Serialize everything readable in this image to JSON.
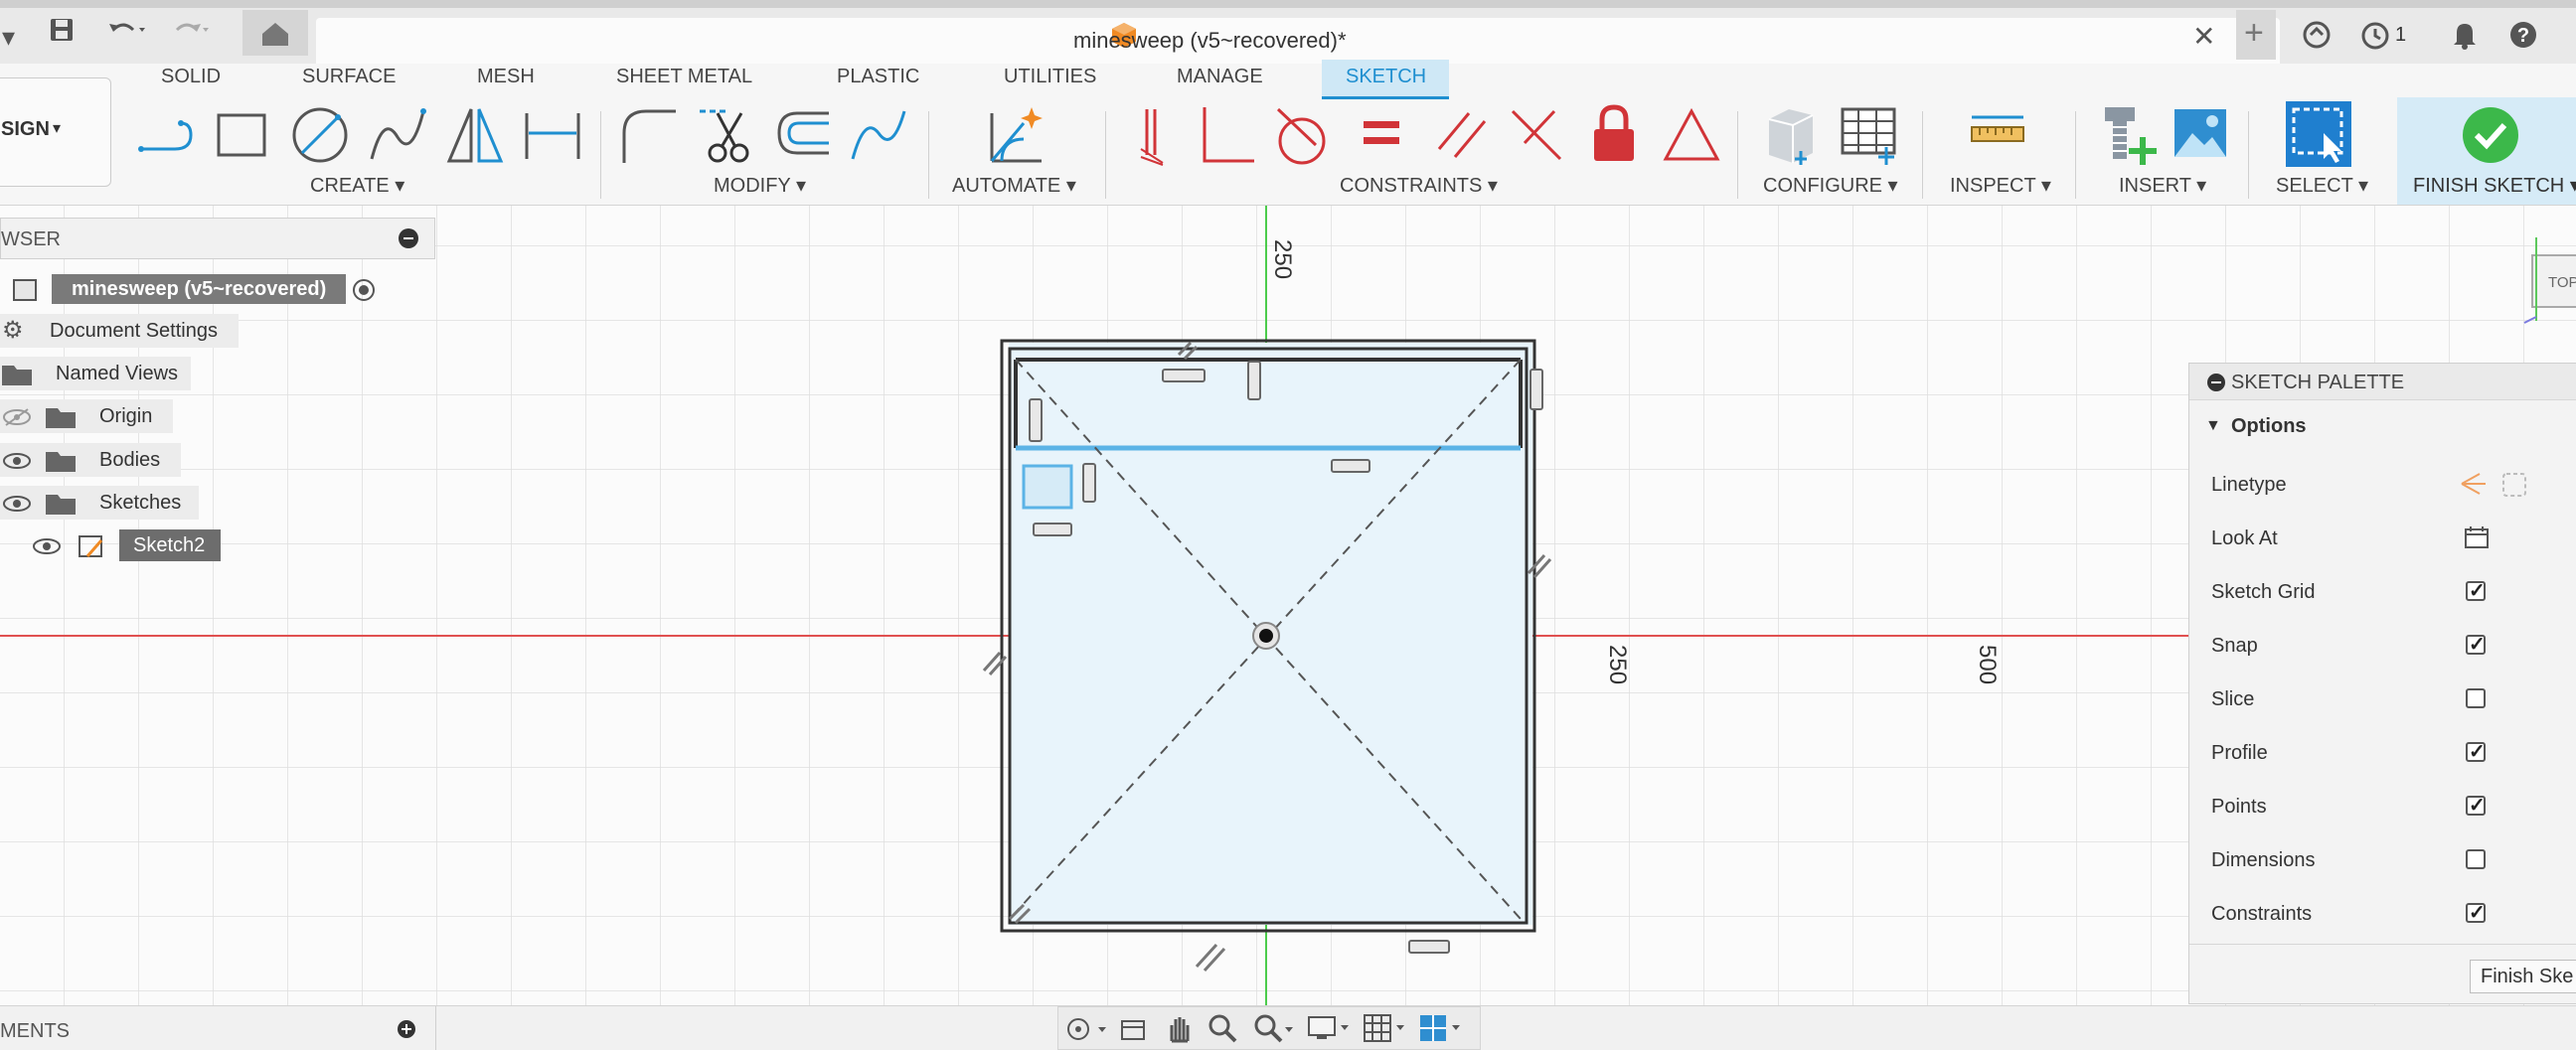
{
  "app": {
    "doc_title": "minesweep (v5~recovered)*",
    "job_count": "1"
  },
  "ribbon": {
    "tabs": [
      "SOLID",
      "SURFACE",
      "MESH",
      "SHEET METAL",
      "PLASTIC",
      "UTILITIES",
      "MANAGE",
      "SKETCH"
    ],
    "workspace": "SIGN",
    "groups": {
      "create": "CREATE",
      "modify": "MODIFY",
      "automate": "AUTOMATE",
      "constraints": "CONSTRAINTS",
      "configure": "CONFIGURE",
      "inspect": "INSPECT",
      "insert": "INSERT",
      "select": "SELECT",
      "finish": "FINISH SKETCH"
    }
  },
  "browser": {
    "title": "WSER",
    "root": "minesweep (v5~recovered)",
    "items": [
      "Document Settings",
      "Named Views",
      "Origin",
      "Bodies",
      "Sketches",
      "Sketch2"
    ]
  },
  "comments": {
    "title": "MENTS"
  },
  "canvas": {
    "axis_labels": [
      "250",
      "250",
      "500"
    ],
    "view_cube": "TOP"
  },
  "palette": {
    "title": "SKETCH PALETTE",
    "section": "Options",
    "rows": [
      {
        "label": "Linetype",
        "kind": "icons"
      },
      {
        "label": "Look At",
        "kind": "icon"
      },
      {
        "label": "Sketch Grid",
        "checked": true
      },
      {
        "label": "Snap",
        "checked": true
      },
      {
        "label": "Slice",
        "checked": false
      },
      {
        "label": "Profile",
        "checked": true
      },
      {
        "label": "Points",
        "checked": true
      },
      {
        "label": "Dimensions",
        "checked": false
      },
      {
        "label": "Constraints",
        "checked": true
      }
    ],
    "finish_button": "Finish Ske"
  },
  "colors": {
    "accent": "#1f8fd0",
    "finish_green": "#3cb84a",
    "constraint_red": "#d13438",
    "x_axis": "#e05050",
    "y_axis": "#4ccc4c",
    "profile_fill": "#e8f4fb"
  }
}
